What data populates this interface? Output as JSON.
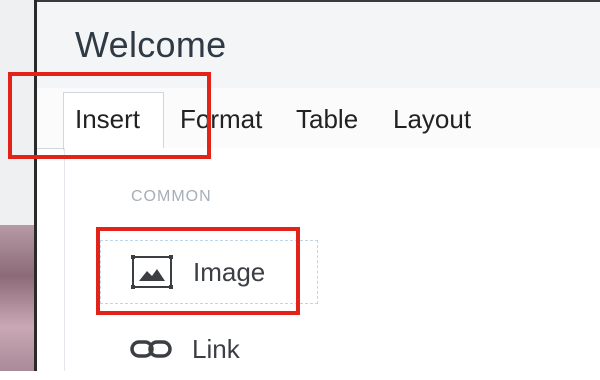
{
  "page": {
    "title": "Welcome"
  },
  "tabs": [
    {
      "label": "Insert",
      "active": true
    },
    {
      "label": "Format",
      "active": false
    },
    {
      "label": "Table",
      "active": false
    },
    {
      "label": "Layout",
      "active": false
    }
  ],
  "panel": {
    "section_label": "COMMON",
    "items": [
      {
        "label": "Image",
        "icon": "image-icon",
        "highlighted": true
      },
      {
        "label": "Link",
        "icon": "link-icon",
        "highlighted": false
      }
    ]
  },
  "colors": {
    "highlight": "#e2231a",
    "text": "#222222",
    "muted": "#a6afb8"
  }
}
